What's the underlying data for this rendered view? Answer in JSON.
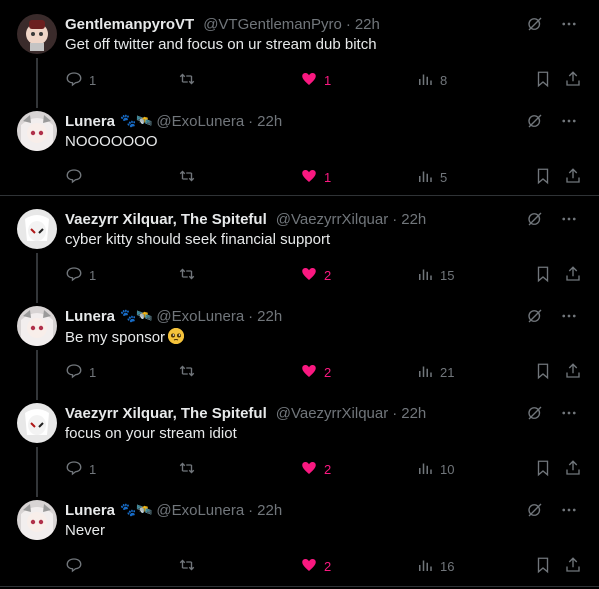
{
  "colors": {
    "bg": "#000000",
    "text": "#e7e9ea",
    "muted": "#71767b",
    "like": "#f91880",
    "divider": "#2f3336"
  },
  "tweets": [
    {
      "name": "GentlemanpyroVT",
      "badges": "",
      "handle": "@VTGentlemanPyro",
      "time": "22h",
      "text": "Get off twitter and focus on ur stream dub bitch",
      "emoji": "",
      "replies": "1",
      "likes": "1",
      "views": "8",
      "avatar": "pyro"
    },
    {
      "name": "Lunera",
      "badges": "🐾🛰️",
      "handle": "@ExoLunera",
      "time": "22h",
      "text": "NOOOOOOO",
      "emoji": "",
      "replies": "",
      "likes": "1",
      "views": "5",
      "avatar": "lunera"
    },
    {
      "name": "Vaezyrr Xilquar, The Spiteful",
      "badges": "",
      "handle": "@VaezyrrXilquar",
      "time": "22h",
      "text": "cyber kitty should seek financial support",
      "emoji": "",
      "replies": "1",
      "likes": "2",
      "views": "15",
      "avatar": "vaezyrr"
    },
    {
      "name": "Lunera",
      "badges": "🐾🛰️",
      "handle": "@ExoLunera",
      "time": "22h",
      "text": "Be my sponsor",
      "emoji": "pleading-face",
      "replies": "1",
      "likes": "2",
      "views": "21",
      "avatar": "lunera"
    },
    {
      "name": "Vaezyrr Xilquar, The Spiteful",
      "badges": "",
      "handle": "@VaezyrrXilquar",
      "time": "22h",
      "text": "focus on your stream idiot",
      "emoji": "",
      "replies": "1",
      "likes": "2",
      "views": "10",
      "avatar": "vaezyrr"
    },
    {
      "name": "Lunera",
      "badges": "🐾🛰️",
      "handle": "@ExoLunera",
      "time": "22h",
      "text": "Never",
      "emoji": "",
      "replies": "",
      "likes": "2",
      "views": "16",
      "avatar": "lunera"
    }
  ]
}
